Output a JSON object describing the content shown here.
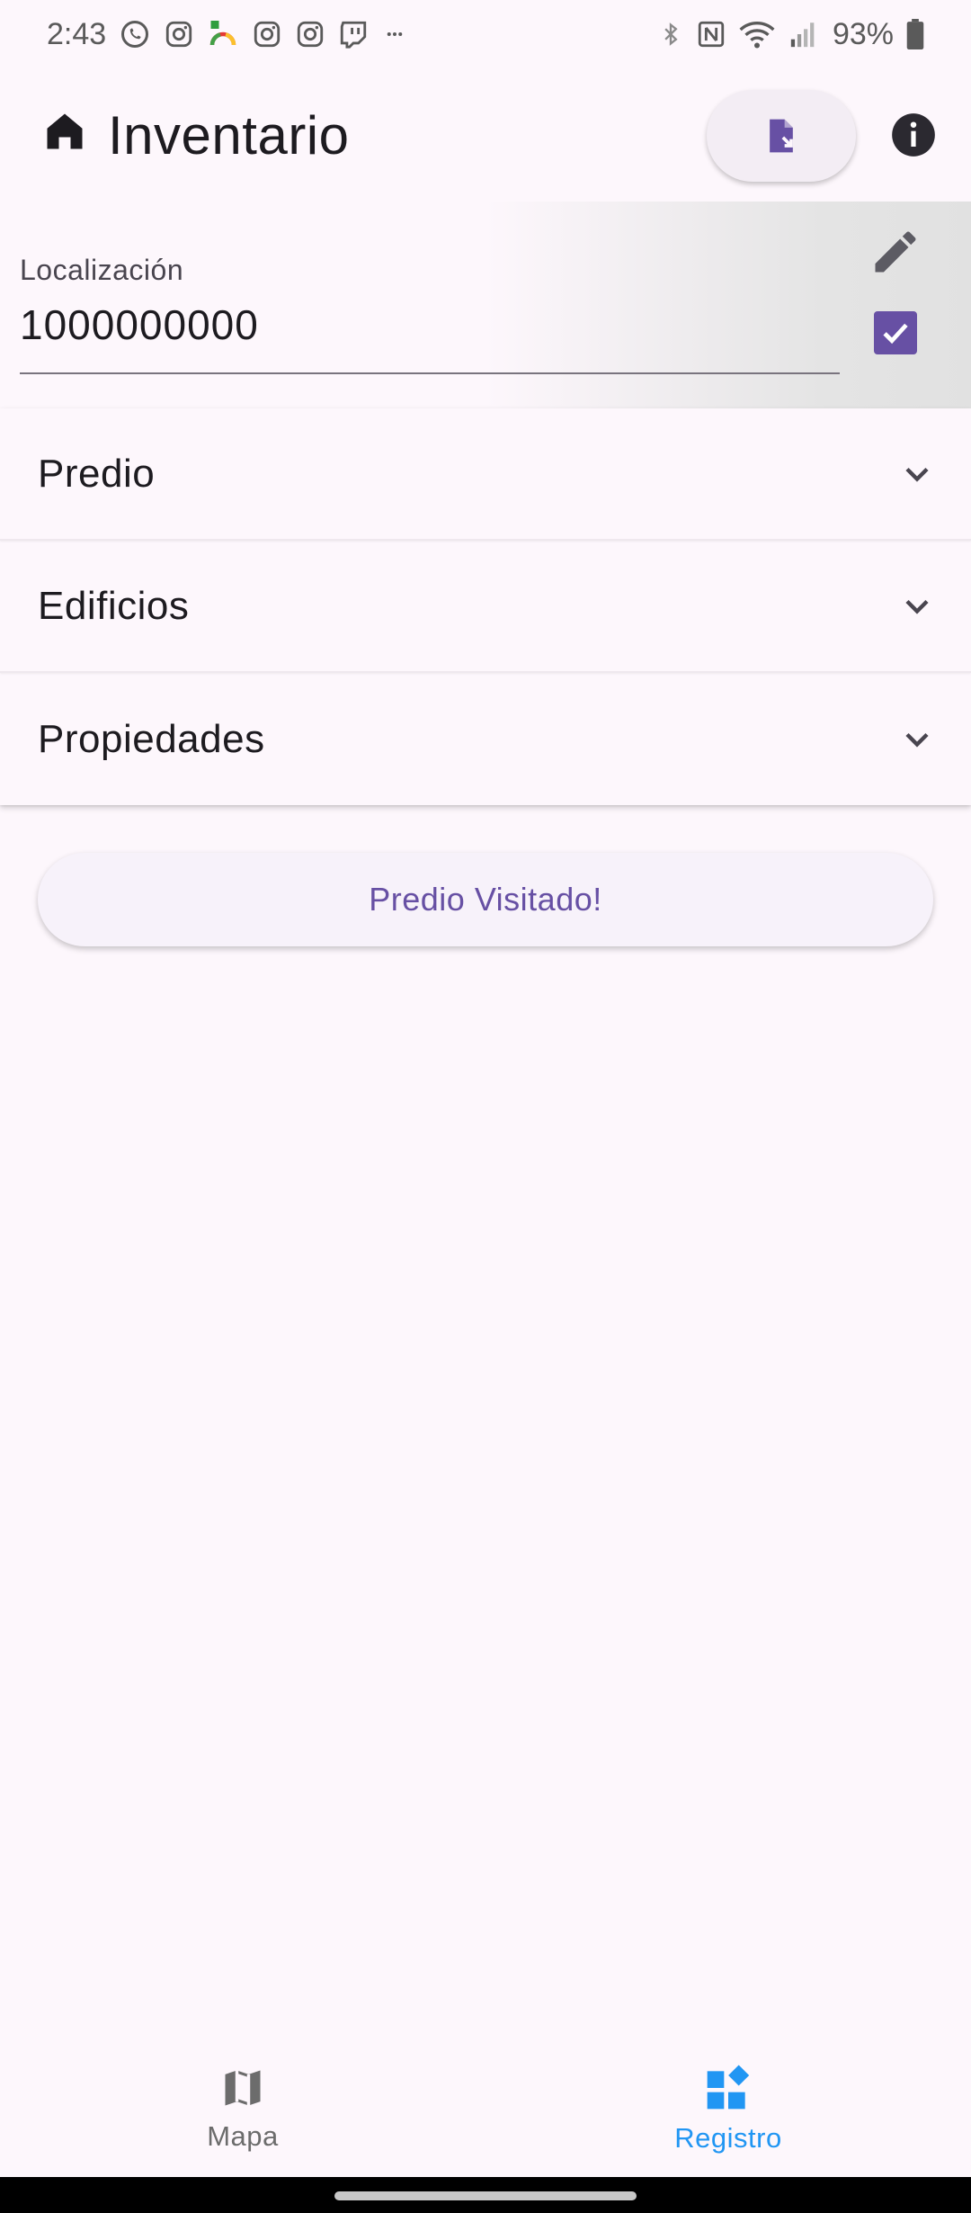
{
  "status_bar": {
    "time": "2:43",
    "battery": "93%",
    "notification_icons": [
      "whatsapp-icon",
      "instagram-icon",
      "speedometer-icon",
      "instagram-icon",
      "instagram-icon",
      "twitch-icon",
      "more-icon"
    ],
    "system_icons": [
      "bluetooth-icon",
      "nfc-icon",
      "wifi-icon",
      "signal-icon",
      "battery-icon"
    ]
  },
  "app_bar": {
    "title": "Inventario",
    "icons": [
      "home-icon",
      "export-document-icon",
      "info-icon"
    ]
  },
  "location": {
    "label": "Localización",
    "value": "1000000000",
    "checked": true,
    "icons": [
      "edit-icon",
      "checkbox-icon"
    ]
  },
  "panels": [
    {
      "label": "Predio"
    },
    {
      "label": "Edificios"
    },
    {
      "label": "Propiedades"
    }
  ],
  "visited_button": {
    "label": "Predio Visitado!"
  },
  "bottom_nav": {
    "items": [
      {
        "label": "Mapa",
        "icon": "map-icon",
        "active": false
      },
      {
        "label": "Registro",
        "icon": "dashboard-icon",
        "active": true
      }
    ]
  },
  "colors": {
    "primary": "#6750a4",
    "active_nav": "#2196f3",
    "background": "#fdf7fc"
  }
}
